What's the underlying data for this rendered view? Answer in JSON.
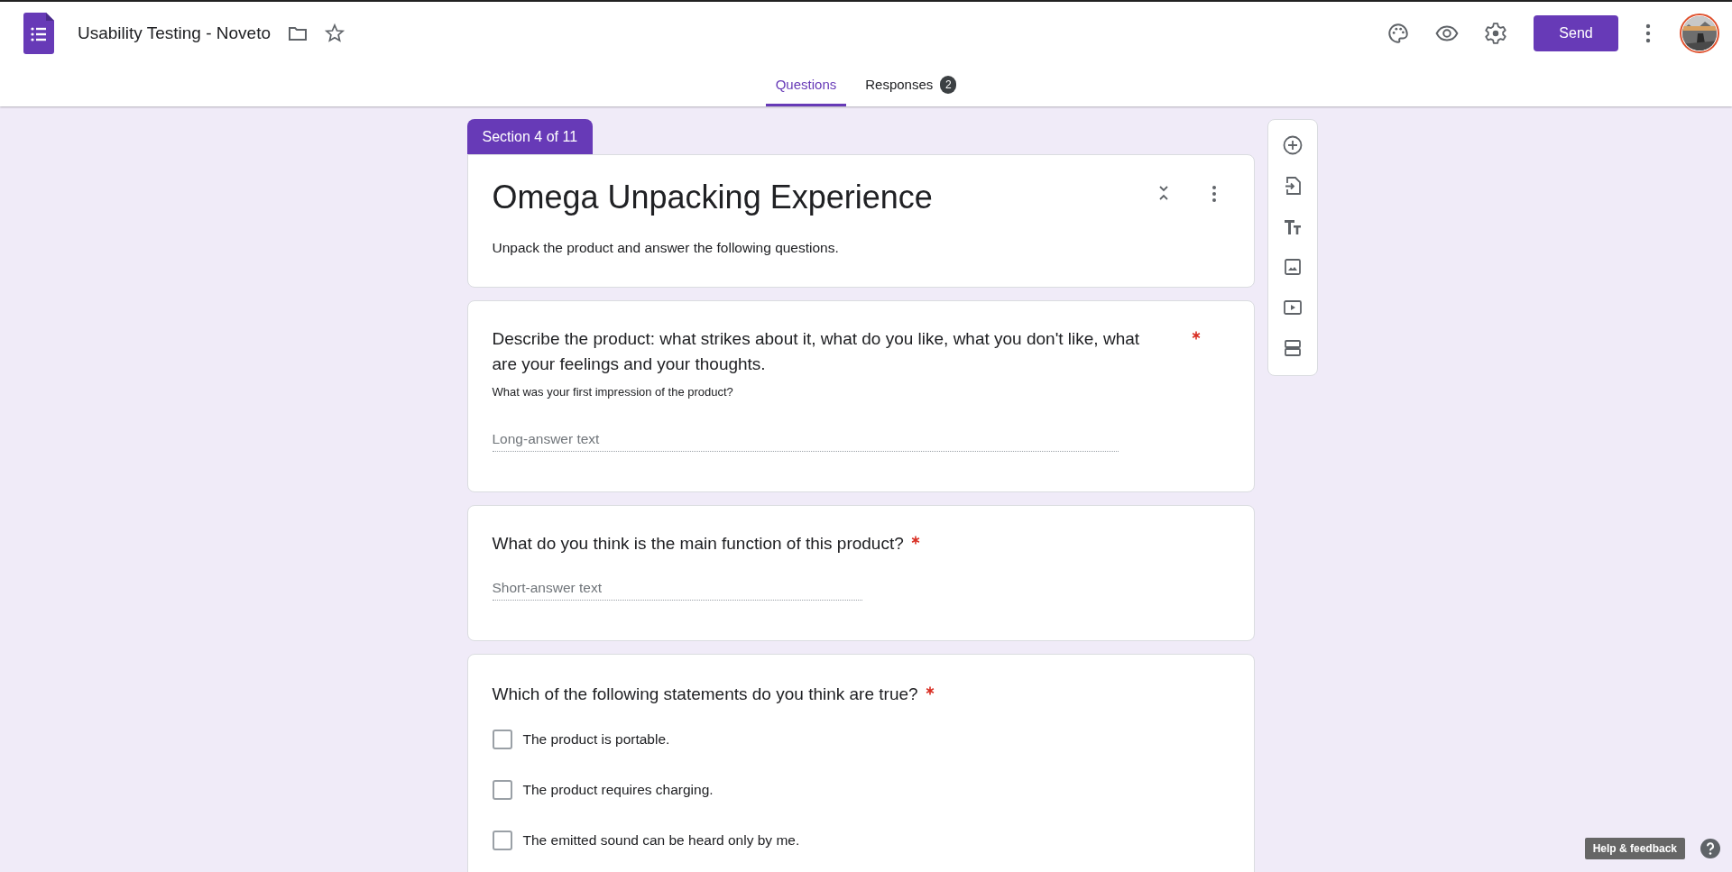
{
  "header": {
    "title": "Usability Testing - Noveto",
    "send": "Send"
  },
  "tabs": [
    {
      "label": "Questions",
      "selected": true
    },
    {
      "label": "Responses",
      "selected": false,
      "badge": "2"
    }
  ],
  "section": {
    "label": "Section 4 of 11",
    "title": "Omega Unpacking Experience",
    "description": "Unpack the product and answer the following questions."
  },
  "questions": [
    {
      "kind": "paragraph",
      "text": "Describe the product: what strikes about it, what do you like, what you don't like, what are your feelings and your thoughts.",
      "required": true,
      "description": "What was your first impression of the product?",
      "placeholder": "Long-answer text"
    },
    {
      "kind": "short",
      "text": "What do you think is the main function of this product?",
      "required": true,
      "placeholder": "Short-answer text"
    },
    {
      "kind": "checkboxes",
      "text": "Which of the following statements do you think are true?",
      "required": true,
      "options": [
        {
          "label": "The product is portable.",
          "checked": false
        },
        {
          "label": "The product requires charging.",
          "checked": false
        },
        {
          "label": "The emitted sound can be heard only by me.",
          "checked": false
        }
      ]
    }
  ],
  "help": "Help & feedback"
}
